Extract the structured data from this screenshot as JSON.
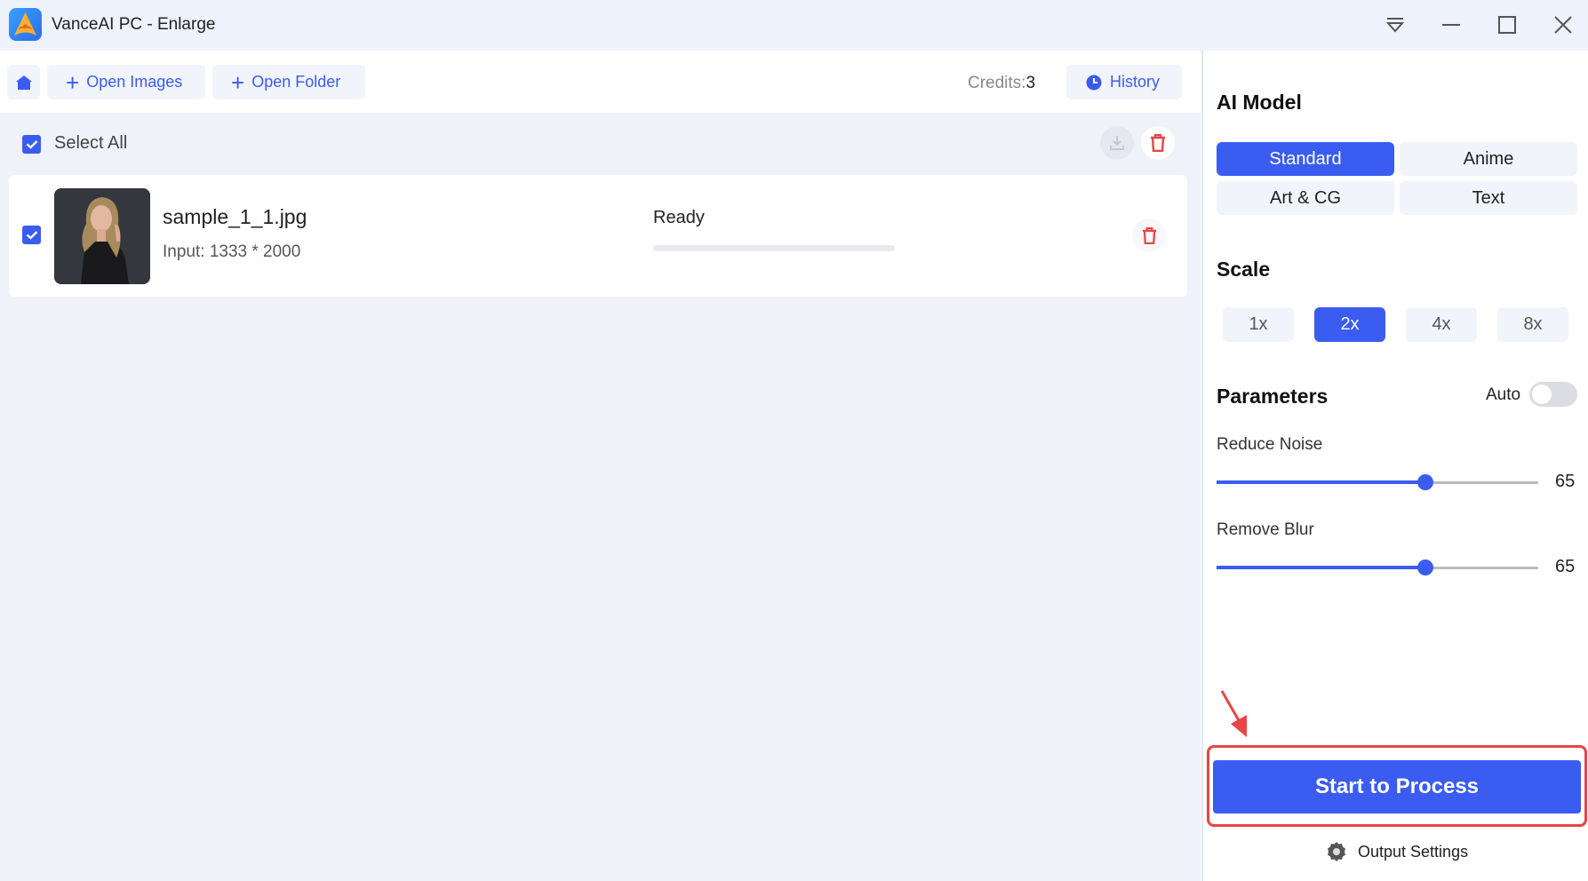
{
  "window": {
    "title": "VanceAI PC - Enlarge",
    "controls": [
      "filter-icon",
      "minimize-icon",
      "maximize-icon",
      "close-icon"
    ]
  },
  "toolbar": {
    "home_icon": "home-icon",
    "open_images_label": "Open Images",
    "open_folder_label": "Open Folder",
    "credits_label": "Credits:",
    "credits_value": "3",
    "history_label": "History"
  },
  "list": {
    "select_all_label": "Select All",
    "select_all_checked": true,
    "items": [
      {
        "filename": "sample_1_1.jpg",
        "input": "Input: 1333 * 2000",
        "status": "Ready",
        "progress_percent": 0,
        "checked": true
      }
    ]
  },
  "panel": {
    "ai_model_title": "AI Model",
    "models": [
      {
        "label": "Standard",
        "active": true
      },
      {
        "label": "Anime",
        "active": false
      },
      {
        "label": "Art & CG",
        "active": false
      },
      {
        "label": "Text",
        "active": false
      }
    ],
    "scale_title": "Scale",
    "scales": [
      {
        "label": "1x",
        "active": false
      },
      {
        "label": "2x",
        "active": true
      },
      {
        "label": "4x",
        "active": false
      },
      {
        "label": "8x",
        "active": false
      }
    ],
    "parameters_title": "Parameters",
    "auto_label": "Auto",
    "auto_enabled": false,
    "params": [
      {
        "label": "Reduce Noise",
        "value": "65",
        "min": 0,
        "max": 100
      },
      {
        "label": "Remove Blur",
        "value": "65",
        "min": 0,
        "max": 100
      }
    ],
    "start_label": "Start to Process",
    "output_settings_label": "Output Settings"
  },
  "colors": {
    "accent": "#3a5cf0",
    "danger": "#e84545",
    "titlebar_bg": "#eef2fc",
    "list_bg": "#f0f2fa"
  }
}
